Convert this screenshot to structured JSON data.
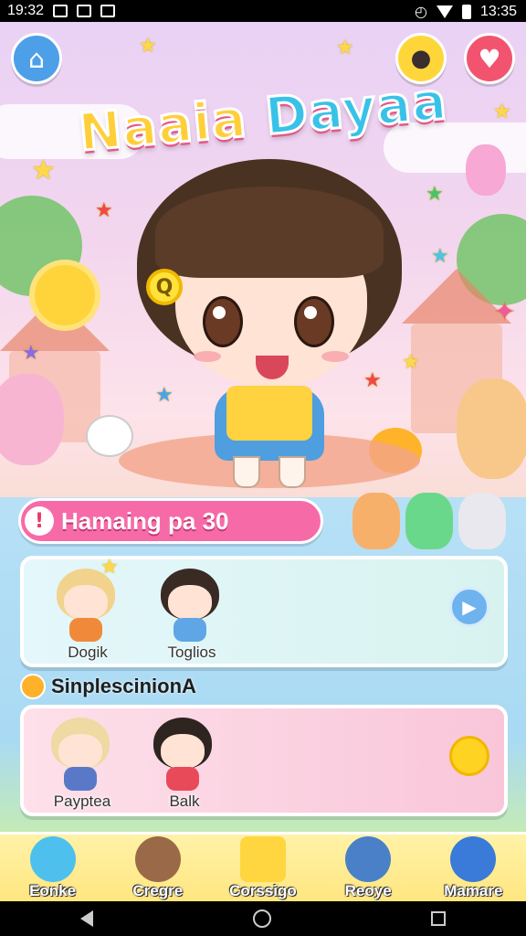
{
  "status_bar": {
    "time_left": "19:32",
    "time_right": "13:35"
  },
  "game_title": {
    "part1": "Naaia",
    "part2": "Dayaa"
  },
  "level_bar": {
    "text": "Hamaing pa 30",
    "alert_glyph": "!"
  },
  "panel1": {
    "characters": [
      {
        "name": "Dogik",
        "hair": "#f1d38d",
        "outfit": "#f08a3a"
      },
      {
        "name": "Toglios",
        "hair": "#3a2a24",
        "outfit": "#5ea6e6"
      }
    ],
    "action": "play-icon"
  },
  "section_label": {
    "text": "SinplescinionА"
  },
  "panel2": {
    "characters": [
      {
        "name": "Payptea",
        "hair": "#eedaa2",
        "outfit": "#5a78c8"
      },
      {
        "name": "Balk",
        "hair": "#2e2420",
        "outfit": "#e84a5a"
      }
    ],
    "action": "coin-icon"
  },
  "bottom_nav": [
    {
      "label": "Eonke",
      "icon": "character-icon",
      "color": "#4ec0ee"
    },
    {
      "label": "Cregre",
      "icon": "bear-icon",
      "color": "#9a6a48"
    },
    {
      "label": "Corssigo",
      "icon": "popcorn-icon",
      "color": "#ffd640"
    },
    {
      "label": "Reoye",
      "icon": "hat-character-icon",
      "color": "#4a80c8"
    },
    {
      "label": "Mamare",
      "icon": "globe-icon",
      "color": "#3a7ad8"
    }
  ],
  "colors": {
    "accent_pink": "#f76aa8",
    "nav_yellow": "#ffe680",
    "sky": "#bfe4f6"
  }
}
